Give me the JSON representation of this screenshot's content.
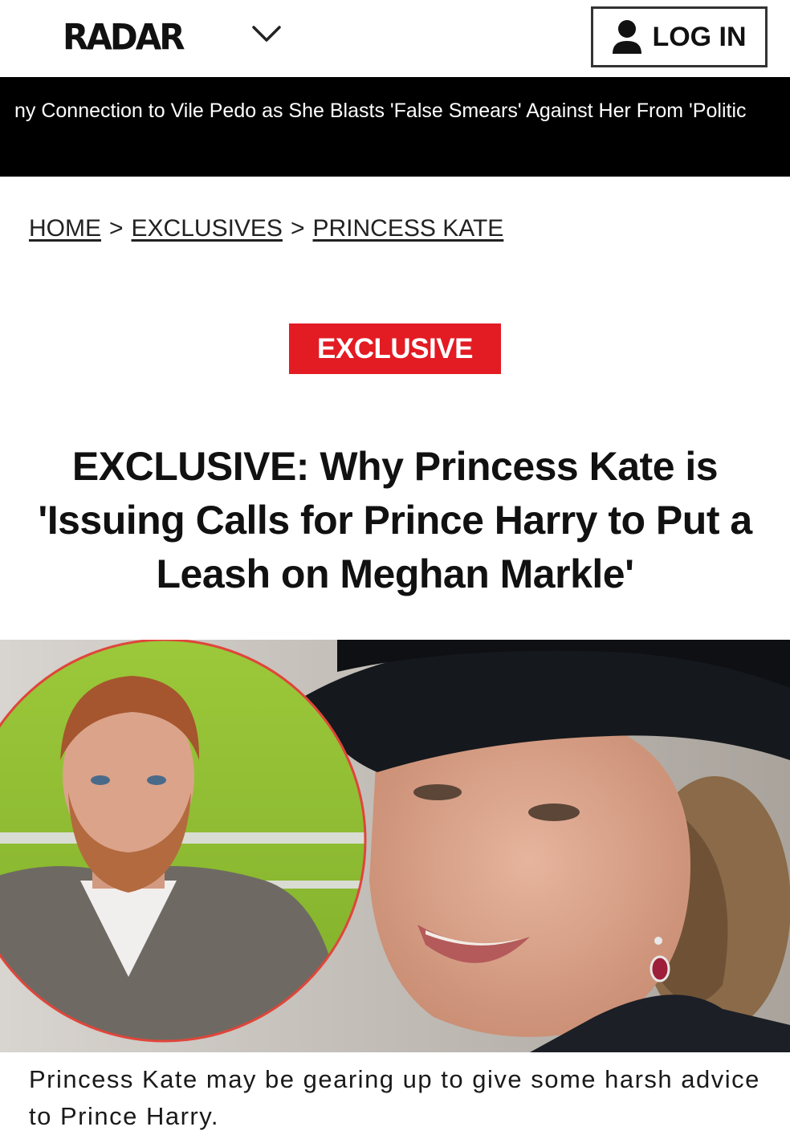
{
  "header": {
    "logo_text": "RADAR",
    "login_label": "LOG IN"
  },
  "ticker": {
    "text": "ny Connection to Vile Pedo as She Blasts 'False Smears' Against Her From 'Politic"
  },
  "breadcrumb": {
    "items": [
      "HOME",
      "EXCLUSIVES",
      "PRINCESS KATE"
    ],
    "separator": ">"
  },
  "article": {
    "badge": "EXCLUSIVE",
    "headline": "EXCLUSIVE: Why Princess Kate is 'Issuing Calls for Prince Harry to Put a Leash on Meghan Markle'",
    "caption": "Princess Kate may be gearing up to give some harsh advice to Prince Harry."
  },
  "colors": {
    "accent": "#e31b23",
    "ticker_bg": "#000000"
  }
}
